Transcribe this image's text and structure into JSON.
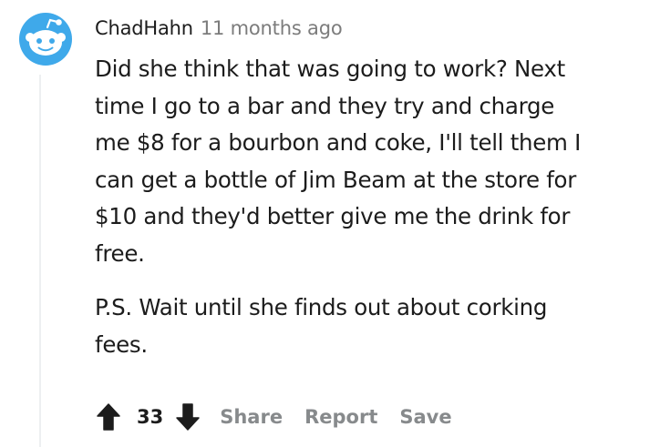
{
  "comment": {
    "author": "ChadHahn",
    "timestamp": "11 months ago",
    "body_lines_1": [
      "Did she think that was going to work? Next",
      "time I go to a bar and they try and charge",
      "me $8 for a bourbon and coke, I'll tell them I",
      "can get a bottle of Jim Beam at the store for",
      "$10 and they'd better give me the drink for",
      "free."
    ],
    "body_lines_2": [
      "P.S. Wait until she finds out about corking",
      "fees."
    ],
    "score": "33"
  },
  "actions": {
    "share": "Share",
    "report": "Report",
    "save": "Save"
  },
  "icons": {
    "avatar": "reddit-snoo-avatar-icon",
    "upvote": "arrow-up-icon",
    "downvote": "arrow-down-icon"
  },
  "colors": {
    "avatar_background": "#3fa9ea",
    "action_text": "#878a8c",
    "timestamp_text": "#7c7c7c"
  }
}
